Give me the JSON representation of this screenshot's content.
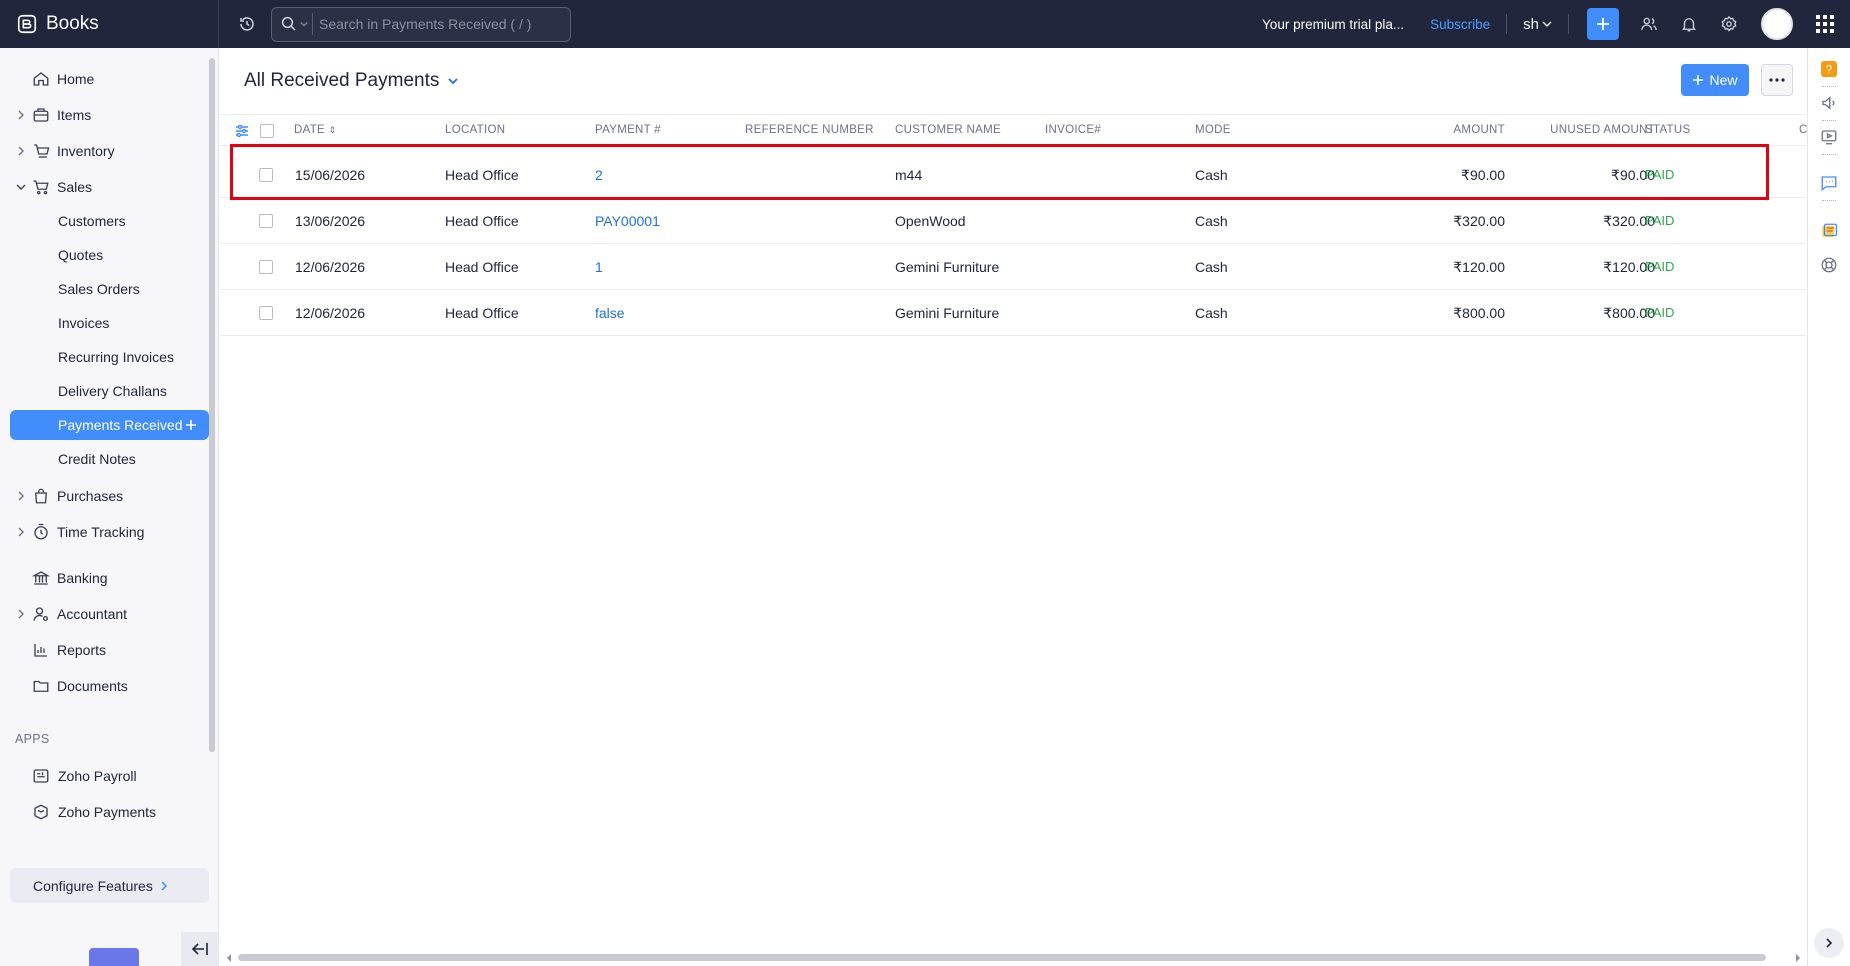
{
  "app": {
    "name": "Books"
  },
  "topbar": {
    "search_placeholder": "Search in Payments Received ( / )",
    "trial_text": "Your premium trial pla...",
    "subscribe_label": "Subscribe",
    "org_label": "sh"
  },
  "sidebar": {
    "items": [
      {
        "label": "Home",
        "icon": "home-icon",
        "expandable": false
      },
      {
        "label": "Items",
        "icon": "items-icon",
        "expandable": true
      },
      {
        "label": "Inventory",
        "icon": "inventory-icon",
        "expandable": true
      },
      {
        "label": "Sales",
        "icon": "cart-icon",
        "expandable": true,
        "expanded": true
      }
    ],
    "sales_sub": [
      {
        "label": "Customers"
      },
      {
        "label": "Quotes"
      },
      {
        "label": "Sales Orders"
      },
      {
        "label": "Invoices"
      },
      {
        "label": "Recurring Invoices"
      },
      {
        "label": "Delivery Challans"
      },
      {
        "label": "Payments Received",
        "active": true
      },
      {
        "label": "Credit Notes"
      }
    ],
    "items_after": [
      {
        "label": "Purchases",
        "icon": "bag-icon",
        "expandable": true
      },
      {
        "label": "Time Tracking",
        "icon": "timer-icon",
        "expandable": true
      },
      {
        "label": "Banking",
        "icon": "bank-icon",
        "expandable": false
      },
      {
        "label": "Accountant",
        "icon": "accountant-icon",
        "expandable": true
      },
      {
        "label": "Reports",
        "icon": "reports-icon",
        "expandable": false
      },
      {
        "label": "Documents",
        "icon": "folder-icon",
        "expandable": false
      }
    ],
    "apps_label": "APPS",
    "apps": [
      {
        "label": "Zoho Payroll",
        "icon": "payroll-icon"
      },
      {
        "label": "Zoho Payments",
        "icon": "payments-icon"
      }
    ],
    "configure_label": "Configure Features"
  },
  "main": {
    "title": "All Received Payments",
    "new_label": "New",
    "columns": [
      "DATE",
      "LOCATION",
      "PAYMENT #",
      "REFERENCE NUMBER",
      "CUSTOMER NAME",
      "INVOICE#",
      "MODE",
      "AMOUNT",
      "UNUSED AMOUNT",
      "STATUS",
      "C"
    ],
    "rows": [
      {
        "date": "15/06/2026",
        "location": "Head Office",
        "payment": "2",
        "reference": "",
        "customer": "m44",
        "invoice": "",
        "mode": "Cash",
        "amount": "₹90.00",
        "unused": "₹90.00",
        "status": "PAID"
      },
      {
        "date": "13/06/2026",
        "location": "Head Office",
        "payment": "PAY00001",
        "reference": "",
        "customer": "OpenWood",
        "invoice": "",
        "mode": "Cash",
        "amount": "₹320.00",
        "unused": "₹320.00",
        "status": "PAID"
      },
      {
        "date": "12/06/2026",
        "location": "Head Office",
        "payment": "1",
        "reference": "",
        "customer": "Gemini Furniture",
        "invoice": "",
        "mode": "Cash",
        "amount": "₹120.00",
        "unused": "₹120.00",
        "status": "PAID"
      },
      {
        "date": "12/06/2026",
        "location": "Head Office",
        "payment": "false",
        "reference": "",
        "customer": "Gemini Furniture",
        "invoice": "",
        "mode": "Cash",
        "amount": "₹800.00",
        "unused": "₹800.00",
        "status": "PAID"
      }
    ]
  },
  "colors": {
    "topbar": "#21263c",
    "accent": "#408dfb",
    "paid": "#2ea650",
    "link": "#1f6fd6",
    "highlight": "#e3000f"
  }
}
